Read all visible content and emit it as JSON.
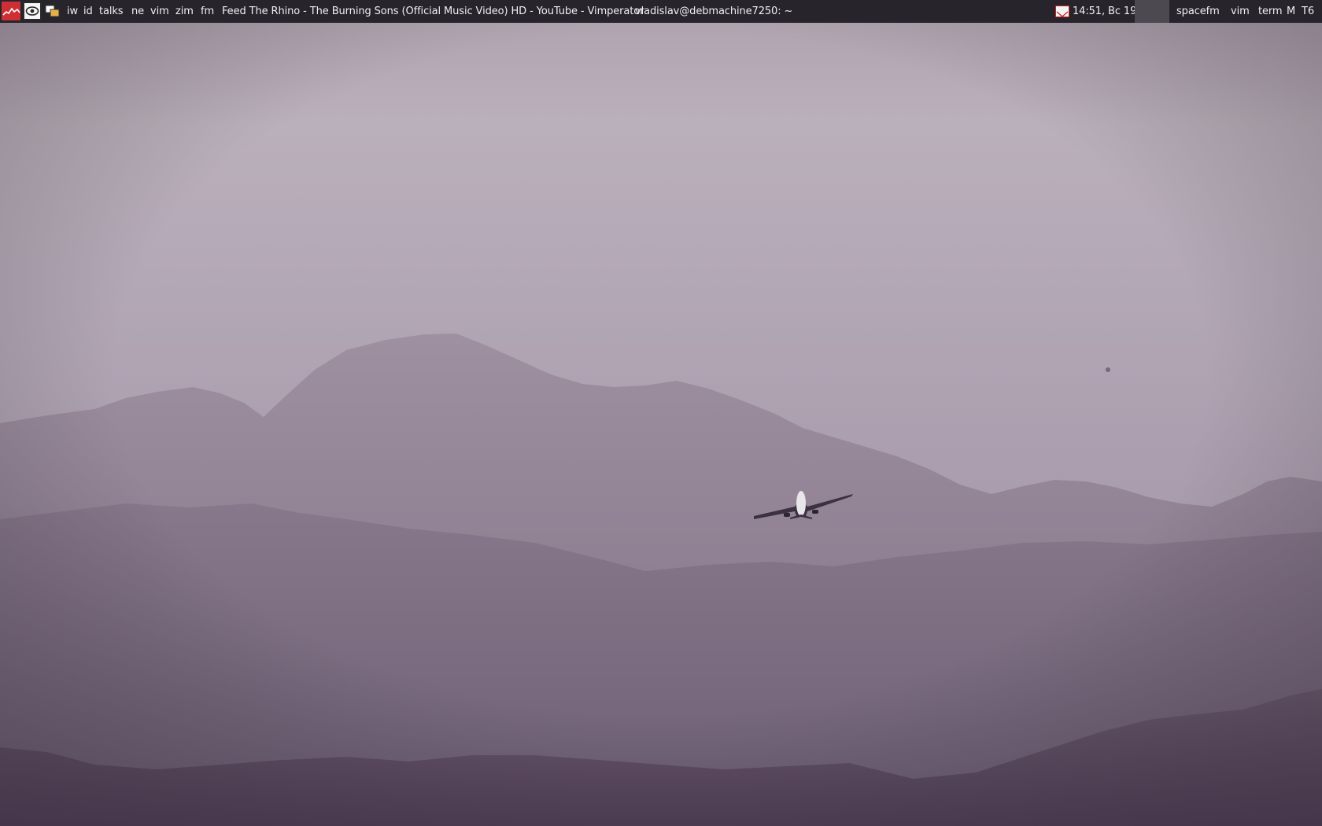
{
  "topbar": {
    "launchers": [
      {
        "name": "system-monitor",
        "icon": "activity-graph-icon"
      },
      {
        "name": "image-viewer",
        "icon": "eye-viewer-icon"
      },
      {
        "name": "window-list",
        "icon": "stacked-windows-icon"
      }
    ],
    "tags": [
      "iw",
      "id",
      "talks",
      "ne",
      "vim",
      "zim",
      "fm"
    ],
    "window_titles": [
      "Feed The Rhino - The Burning Sons (Official Music Video) HD - YouTube - Vimperator",
      "vladislav@debmachine7250: ~"
    ],
    "clock": "14:51, Вс 19",
    "workspaces": [
      "spacefm",
      "vim",
      "term",
      "M",
      "T6"
    ],
    "notification_icon": "mail-icon",
    "colors": {
      "bar_background": "#27242c",
      "bar_text": "#f1eff2",
      "sysmon_icon": "#cd2f35",
      "active_workspace": "#4d4950"
    }
  },
  "wallpaper": {
    "description_colors": {
      "sky": "#b9adb9",
      "near_mountains": "#5a4a5d",
      "far_mountains": "#948597"
    }
  }
}
